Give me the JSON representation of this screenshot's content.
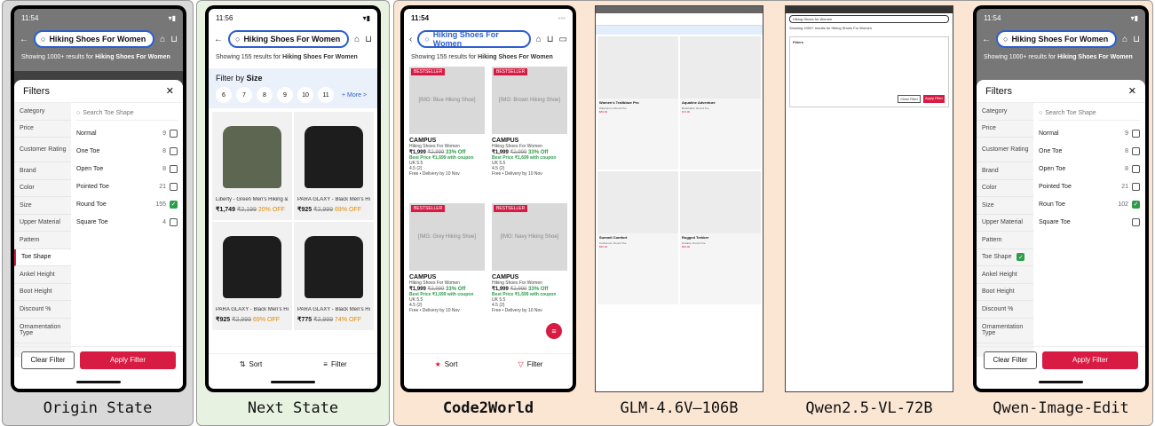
{
  "captions": {
    "origin": "Origin State",
    "next": "Next State",
    "code2world": "Code2World",
    "glm": "GLM-4.6V–106B",
    "qwen_vl": "Qwen2.5-VL-72B",
    "qwen_edit": "Qwen-Image-Edit"
  },
  "colors": {
    "accent": "#d81b42",
    "search_border": "#2c5fcf",
    "checked": "#2e9c4a"
  },
  "origin": {
    "time": "11:54",
    "search_text": "Hiking Shoes For Women",
    "results_prefix": "Showing 1000+ results for ",
    "results_query": "Hiking Shoes For Women",
    "filters_title": "Filters",
    "search_toe": "Search Toe Shape",
    "categories": [
      "Category",
      "Price",
      "Customer Rating",
      "Brand",
      "Color",
      "Size",
      "Upper Material",
      "Pattern",
      "Toe Shape",
      "Ankel Height",
      "Boot Height",
      "Discount %",
      "Ornamentation Type"
    ],
    "options": [
      {
        "label": "Normal",
        "count": "9",
        "checked": false
      },
      {
        "label": "One Toe",
        "count": "8",
        "checked": false
      },
      {
        "label": "Open Toe",
        "count": "8",
        "checked": false
      },
      {
        "label": "Pointed Toe",
        "count": "21",
        "checked": false
      },
      {
        "label": "Round Toe",
        "count": "155",
        "checked": true
      },
      {
        "label": "Square Toe",
        "count": "4",
        "checked": false
      }
    ],
    "clear": "Clear Filter",
    "apply": "Apply Filter"
  },
  "next": {
    "time": "11:56",
    "search_text": "Hiking Shoes For Women",
    "results_prefix": "Showing 155 results for ",
    "results_query": "Hiking Shoes For Women",
    "size_prefix": "Filter by ",
    "size_word": "Size",
    "sizes": [
      "6",
      "7",
      "8",
      "9",
      "10",
      "11"
    ],
    "more": "+ More >",
    "products": [
      {
        "title": "Liberty - Green Men's Hiking & Tr...",
        "price": "₹1,749",
        "mrp": "₹2,199",
        "off": "20% OFF"
      },
      {
        "title": "PARA GLAXY - Black Men's Hi...",
        "price": "₹925",
        "mrp": "₹2,999",
        "off": "69% OFF"
      },
      {
        "title": "PARA GLAXY - Black Men's Hiking...",
        "price": "₹925",
        "mrp": "₹2,999",
        "off": "69% OFF"
      },
      {
        "title": "PARA GLAXY - Black Men's Hiking...",
        "price": "₹775",
        "mrp": "₹2,999",
        "off": "74% OFF"
      }
    ],
    "sort": "Sort",
    "filter": "Filter"
  },
  "code2world": {
    "time": "11:54",
    "search_text": "Hiking Shoes For Women",
    "results_prefix": "Showing 155 results for ",
    "results_query": "Hiking Shoes For Women",
    "badge": "BESTSELLER",
    "cards": [
      {
        "img": "[IMG: Blue Hiking Shoe]"
      },
      {
        "img": "[IMG: Brown Hiking Shoe]"
      },
      {
        "img": "[IMG: Grey Hiking Shoe]"
      },
      {
        "img": "[IMG: Navy Hiking Shoe]"
      }
    ],
    "brand": "CAMPUS",
    "sub": "Hiking Shoes For Women",
    "price": "₹1,999",
    "mrp": "₹2,999",
    "off": "33% Off",
    "best": "Best Price ₹1,699 with coupon",
    "uk": "UK 5.5",
    "rating": "4.5 (2)",
    "delivery": "Free • Delivery by 10 Nov",
    "sort": "Sort",
    "filter": "Filter"
  },
  "glm": {
    "cards": [
      {
        "title": "Women's Trailblaze Pro",
        "sub": "Waterproof, Round Toe",
        "price": "$89.99"
      },
      {
        "title": "Aqualine Adventure",
        "sub": "Breathable, Round Toe",
        "price": "$74.99"
      },
      {
        "title": "Summit Comfort",
        "sub": "Cushioned, Round Toe",
        "price": "$65.00"
      },
      {
        "title": "Rugged Trekker",
        "sub": "Durable, Round Toe",
        "price": "$99.00"
      }
    ]
  },
  "qwen_vl": {
    "search": "Hiking Shoes for Women",
    "results": "Showing 1000+ results for Hiking Shoes For Women",
    "title": "Filters",
    "clear": "Clear Filter",
    "apply": "Apply Filter"
  },
  "qwen_edit": {
    "time": "11:54",
    "search_text": "Hiking Shoes For Women",
    "results_prefix": "Showing 1000+ results for ",
    "results_query": "Hiking Shoes For Women",
    "filters_title": "Filters",
    "search_toe": "Search Toe Shape",
    "options": [
      {
        "label": "Normal",
        "count": "9",
        "checked": false
      },
      {
        "label": "One Toe",
        "count": "8",
        "checked": false
      },
      {
        "label": "Open Toe",
        "count": "8",
        "checked": false
      },
      {
        "label": "Pointed Toe",
        "count": "21",
        "checked": false
      },
      {
        "label": "Roun Toe",
        "count": "102",
        "checked": true
      },
      {
        "label": "Square Toe",
        "count": "",
        "checked": false
      }
    ],
    "clear": "Clear Filter",
    "apply": "Apply Filter"
  }
}
